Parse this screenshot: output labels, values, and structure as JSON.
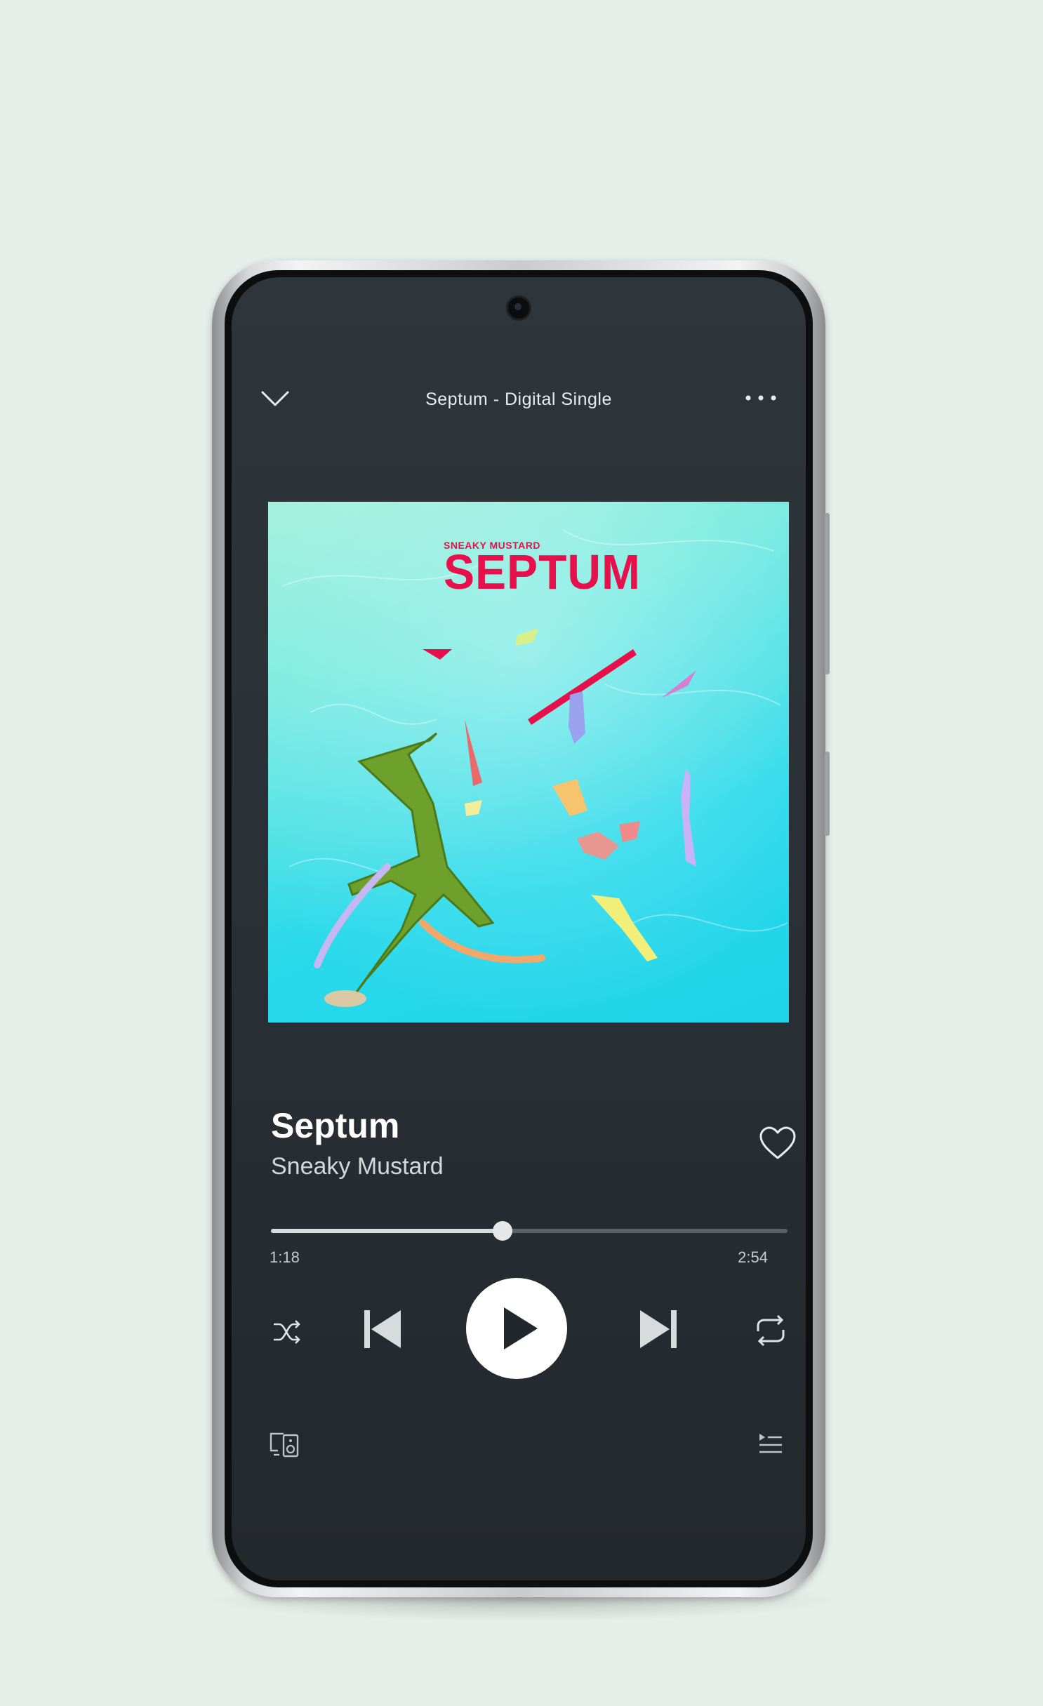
{
  "header": {
    "title": "Septum - Digital Single",
    "collapse_icon": "chevron-down-icon",
    "more_icon": "more-horizontal-icon"
  },
  "artwork": {
    "brand_text": "SNEAKY MUSTARD",
    "title_text": "SEPTUM"
  },
  "track": {
    "title": "Septum",
    "artist": "Sneaky Mustard",
    "like_icon": "heart-outline-icon"
  },
  "progress": {
    "current_time": "1:18",
    "total_time": "2:54",
    "fraction": 0.448
  },
  "controls": {
    "shuffle_icon": "shuffle-icon",
    "previous_icon": "skip-previous-icon",
    "play_icon": "play-icon",
    "next_icon": "skip-next-icon",
    "repeat_icon": "repeat-icon"
  },
  "footer": {
    "devices_icon": "connect-devices-icon",
    "queue_icon": "queue-icon"
  },
  "colors": {
    "page_background": "#e6eee9",
    "screen_background": "#2a3036",
    "accent_text": "#ffffff",
    "artwork_title": "#e8104a",
    "artwork_sky": "#28d9ea"
  }
}
